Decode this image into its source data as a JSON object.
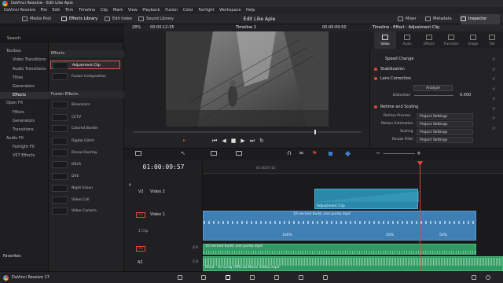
{
  "window": {
    "title": "DaVinci Resolve - Edit Like Apie"
  },
  "menu": [
    "DaVinci Resolve",
    "File",
    "Edit",
    "Trim",
    "Timeline",
    "Clip",
    "Mark",
    "View",
    "Playback",
    "Fusion",
    "Color",
    "Fairlight",
    "Workspace",
    "Help"
  ],
  "toolbar": {
    "media_pool": "Media Pool",
    "effects_library": "Effects Library",
    "edit_index": "Edit Index",
    "sound_library": "Sound Library",
    "project_title": "Edit Like Apie",
    "mixer": "Mixer",
    "metadata": "Metadata",
    "inspector": "Inspector"
  },
  "search": {
    "label": "Search"
  },
  "sidebar": {
    "items": [
      "Toolbox",
      "Video Transitions",
      "Audio Transitions",
      "Titles",
      "Generators",
      "Effects",
      "Open FX",
      "Filters",
      "Generators",
      "Transitions",
      "Audio FX",
      "Fairlight FX",
      "VST Effects"
    ],
    "selected": "Effects",
    "favorites": "Favorites"
  },
  "effects_panel": {
    "section_effects": "Effects",
    "items_effects": [
      "Adjustment Clip",
      "Fusion Composition"
    ],
    "section_fusion": "Fusion Effects",
    "items_fusion": [
      "Binoculars",
      "CCTV",
      "Colored Border",
      "Digital Glitch",
      "Drone Overlay",
      "DSLR",
      "DVE",
      "Night Vision",
      "Video Call",
      "Video Camera"
    ]
  },
  "viewer": {
    "zoom": "28%",
    "timecode_left": "00:00:12:35",
    "timeline_name": "Timeline 1",
    "timecode_right": "00:00:09:50"
  },
  "inspector": {
    "header": "Timeline - Effect - Adjustment Clip",
    "tabs": [
      "Video",
      "Audio",
      "Effects",
      "Transition",
      "Image",
      "File"
    ],
    "active_tab": "Video",
    "speed_change": "Speed Change",
    "stabilization": "Stabilization",
    "lens_correction": "Lens Correction",
    "analyze": "Analyze",
    "distortion_label": "Distortion",
    "distortion_value": "0.000",
    "retime_scaling": "Retime and Scaling",
    "retime_process_label": "Retime Process",
    "retime_process_value": "Project Settings",
    "motion_estimation_label": "Motion Estimation",
    "motion_estimation_value": "Project Settings",
    "scaling_label": "Scaling",
    "scaling_value": "Project Settings",
    "resize_filter_label": "Resize Filter",
    "resize_filter_value": "Project Settings"
  },
  "timeline": {
    "timecode": "01:00:09:57",
    "ruler_label": "01:00:07:15",
    "tracks": {
      "v2": {
        "id": "V2",
        "name": "Video 2"
      },
      "v1": {
        "id": "V1",
        "name": "Video 1"
      },
      "a1": {
        "id": "A1"
      },
      "a2": {
        "id": "A2"
      }
    },
    "clip_count_v1": "1 Clip",
    "adjustment_clip": "Adjustment Clip",
    "v1_clip": "10 second build, one pump.mp4",
    "speed_markers": [
      "100%",
      "50%",
      "50%"
    ],
    "a1_clip": "10 second build, one pump.mp4",
    "a2_clip": "Rihat - So Long (Official Music Video).mp3",
    "a_levels": [
      "2.0",
      "2.0"
    ]
  },
  "footer": {
    "app": "DaVinci Resolve 17"
  },
  "colors": {
    "accent": "#e2463a",
    "video_clip": "#3f7fb3",
    "audio_clip": "#2f9a62",
    "adjustment_clip": "#2a88a8"
  }
}
